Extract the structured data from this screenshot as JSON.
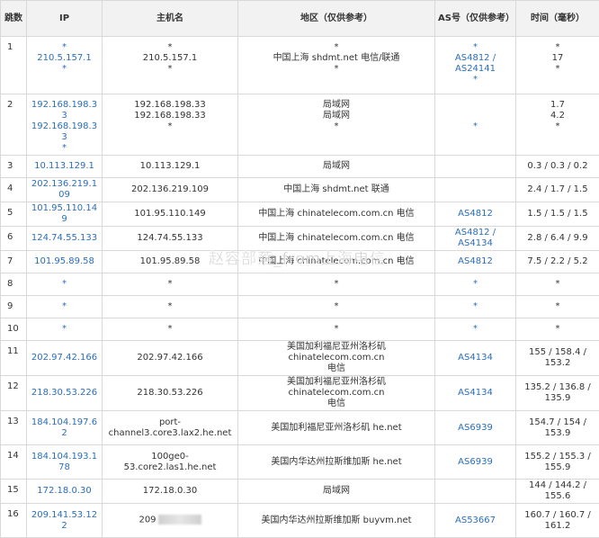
{
  "headers": {
    "hop": "跳数",
    "ip": "IP",
    "host": "主机名",
    "region": "地区（仅供参考）",
    "asn": "AS号（仅供参考）",
    "time": "时间（毫秒）"
  },
  "rows": [
    {
      "hop": "1",
      "ip": [
        "*",
        "210.5.157.1",
        "*"
      ],
      "host": [
        "*",
        "210.5.157.1",
        "*"
      ],
      "region": [
        "*",
        "中国上海 shdmt.net 电信/联通",
        "*"
      ],
      "asn": [
        "*",
        "AS4812 /",
        "AS24141",
        "*"
      ],
      "time": [
        "*",
        "17",
        "*"
      ]
    },
    {
      "hop": "2",
      "ip": [
        "192.168.198.33",
        "192.168.198.33",
        "*"
      ],
      "host": [
        "192.168.198.33",
        "192.168.198.33",
        "*"
      ],
      "region": [
        "局域网",
        "局域网",
        "*"
      ],
      "asn": [
        "",
        "",
        "*"
      ],
      "time": [
        "1.7",
        "4.2",
        "*"
      ]
    },
    {
      "hop": "3",
      "ip": [
        "10.113.129.1"
      ],
      "host": [
        "10.113.129.1"
      ],
      "region": [
        "局域网"
      ],
      "asn": [
        ""
      ],
      "time": [
        "0.3 / 0.3 / 0.2"
      ]
    },
    {
      "hop": "4",
      "ip": [
        "202.136.219.109"
      ],
      "host": [
        "202.136.219.109"
      ],
      "region": [
        "中国上海 shdmt.net 联通"
      ],
      "asn": [
        ""
      ],
      "time": [
        "2.4 / 1.7 / 1.5"
      ]
    },
    {
      "hop": "5",
      "ip": [
        "101.95.110.149"
      ],
      "host": [
        "101.95.110.149"
      ],
      "region": [
        "中国上海 chinatelecom.com.cn 电信"
      ],
      "asn": [
        "AS4812"
      ],
      "time": [
        "1.5 / 1.5 / 1.5"
      ]
    },
    {
      "hop": "6",
      "ip": [
        "124.74.55.133"
      ],
      "host": [
        "124.74.55.133"
      ],
      "region": [
        "中国上海 chinatelecom.com.cn 电信"
      ],
      "asn": [
        "AS4812 / AS4134"
      ],
      "time": [
        "2.8 / 6.4 / 9.9"
      ]
    },
    {
      "hop": "7",
      "ip": [
        "101.95.89.58"
      ],
      "host": [
        "101.95.89.58"
      ],
      "region": [
        "中国上海 chinatelecom.com.cn 电信"
      ],
      "asn": [
        "AS4812"
      ],
      "time": [
        "7.5 / 2.2 / 5.2"
      ]
    },
    {
      "hop": "8",
      "ip": [
        "*"
      ],
      "host": [
        "*"
      ],
      "region": [
        "*"
      ],
      "asn": [
        "*"
      ],
      "time": [
        "*"
      ]
    },
    {
      "hop": "9",
      "ip": [
        "*"
      ],
      "host": [
        "*"
      ],
      "region": [
        "*"
      ],
      "asn": [
        "*"
      ],
      "time": [
        "*"
      ]
    },
    {
      "hop": "10",
      "ip": [
        "*"
      ],
      "host": [
        "*"
      ],
      "region": [
        "*"
      ],
      "asn": [
        "*"
      ],
      "time": [
        "*"
      ]
    },
    {
      "hop": "11",
      "ip": [
        "202.97.42.166"
      ],
      "host": [
        "202.97.42.166"
      ],
      "region": [
        "美国加利福尼亚州洛杉矶 chinatelecom.com.cn",
        "电信"
      ],
      "asn": [
        "AS4134"
      ],
      "time": [
        "155 / 158.4 / 153.2"
      ]
    },
    {
      "hop": "12",
      "ip": [
        "218.30.53.226"
      ],
      "host": [
        "218.30.53.226"
      ],
      "region": [
        "美国加利福尼亚州洛杉矶 chinatelecom.com.cn",
        "电信"
      ],
      "asn": [
        "AS4134"
      ],
      "time": [
        "135.2 / 136.8 /",
        "135.9"
      ]
    },
    {
      "hop": "13",
      "ip": [
        "184.104.197.62"
      ],
      "host": [
        "port-",
        "channel3.core3.lax2.he.net"
      ],
      "region": [
        "美国加利福尼亚州洛杉矶 he.net"
      ],
      "asn": [
        "AS6939"
      ],
      "time": [
        "154.7 / 154 / 153.9"
      ]
    },
    {
      "hop": "14",
      "ip": [
        "184.104.193.178"
      ],
      "host": [
        "100ge0-53.core2.las1.he.net"
      ],
      "region": [
        "美国内华达州拉斯维加斯 he.net"
      ],
      "asn": [
        "AS6939"
      ],
      "time": [
        "155.2 / 155.3 /",
        "155.9"
      ]
    },
    {
      "hop": "15",
      "ip": [
        "172.18.0.30"
      ],
      "host": [
        "172.18.0.30"
      ],
      "region": [
        "局域网"
      ],
      "asn": [
        ""
      ],
      "time": [
        "144 / 144.2 / 155.6"
      ]
    },
    {
      "hop": "16",
      "ip": [
        "209.141.53.122"
      ],
      "host": [
        "209"
      ],
      "region": [
        "美国内华达州拉斯维加斯 buyvm.net"
      ],
      "asn": [
        "AS53667"
      ],
      "time": [
        "160.7 / 160.7 /",
        "161.2"
      ]
    }
  ],
  "watermark": "赵容部落_from上海电信"
}
